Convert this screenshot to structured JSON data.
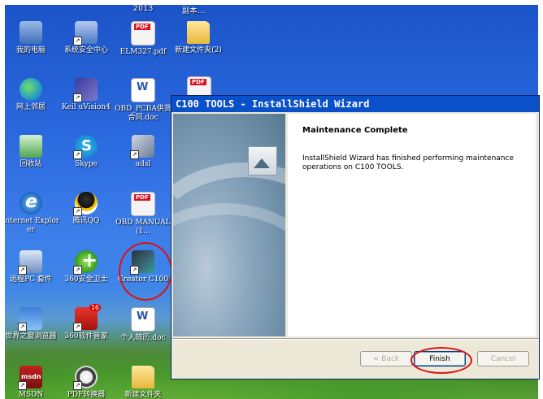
{
  "desktop": {
    "top_fragments": [
      "2013",
      "副本..."
    ],
    "icons": [
      {
        "label": "我的电脑",
        "icon": "computer-icon"
      },
      {
        "label": "系统安全中心",
        "icon": "security-center-icon"
      },
      {
        "label": "ELM327.pdf",
        "icon": "pdf-icon"
      },
      {
        "label": "新建文件夹(2)",
        "icon": "folder-icon"
      },
      {
        "label": "网上邻居",
        "icon": "network-icon"
      },
      {
        "label": "Keil uVision4",
        "icon": "keil-icon"
      },
      {
        "label": "OBD_PCBA供货合同.doc",
        "icon": "word-doc-icon"
      },
      {
        "label": "回收站",
        "icon": "recycle-bin-icon"
      },
      {
        "label": "Skype",
        "icon": "skype-icon"
      },
      {
        "label": "adsl",
        "icon": "adsl-icon"
      },
      {
        "label": "Internet Explorer",
        "icon": "ie-icon"
      },
      {
        "label": "腾讯QQ",
        "icon": "qq-icon"
      },
      {
        "label": "OBD MANUAL(1...",
        "icon": "pdf-icon"
      },
      {
        "label": "远程PC 套件",
        "icon": "pc-suite-icon"
      },
      {
        "label": "360安全卫士",
        "icon": "360-safe-icon"
      },
      {
        "label": "Creator C100",
        "icon": "creator-icon"
      },
      {
        "label": "世界之窗浏览器",
        "icon": "theworld-browser-icon"
      },
      {
        "label": "360软件管家",
        "icon": "360-software-icon"
      },
      {
        "label": "个人简历.doc",
        "icon": "word-doc-icon"
      },
      {
        "label": "MSDN",
        "icon": "msdn-icon"
      },
      {
        "label": "PDF转换器",
        "icon": "pdf-converter-icon"
      },
      {
        "label": "新建文件夹",
        "icon": "folder-icon"
      }
    ]
  },
  "dialog": {
    "title": "C100 TOOLS - InstallShield Wizard",
    "heading": "Maintenance Complete",
    "message": "InstallShield Wizard has finished performing maintenance operations on C100 TOOLS.",
    "buttons": {
      "back": "< Back",
      "finish": "Finish",
      "cancel": "Cancel"
    }
  },
  "colors": {
    "titlebar": "#0a50c8",
    "annotation_ring": "#e01010"
  }
}
